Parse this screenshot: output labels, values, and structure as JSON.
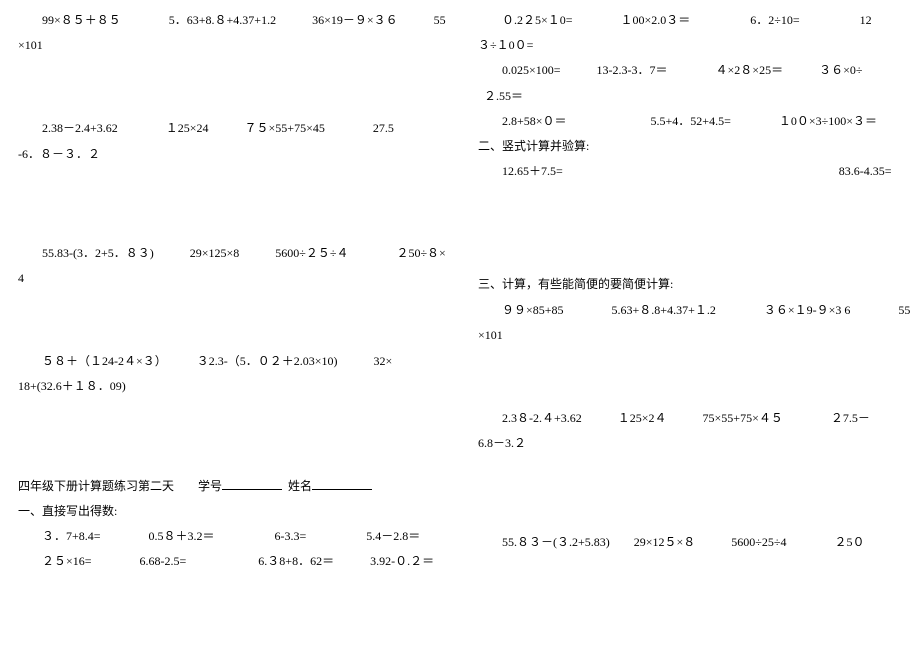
{
  "left": {
    "l1": "99×８５＋８５　　　　5．63+8.８+4.37+1.2　　　36×19－９×３６　　　55",
    "l2": "×101",
    "l3": "2.38－2.4+3.62　　　　１25×24　　　７５×55+75×45　　　　27.5",
    "l4": "-6．８－３．２",
    "l5": "55.83-(3．2+5．８３)　　　29×125×8　　　5600÷２５÷４　　　　２50÷８×",
    "l6": "4",
    "l7": "５８＋（１24-2４×３）　　　３2.3-（5．０２＋2.03×10)　　　32×",
    "l8": "18+(32.6＋１８．09)",
    "title": "四年级下册计算题练习第二天",
    "xuehao": "学号",
    "xingming": "姓名",
    "sec1": "一、直接写出得数:",
    "row1a": "３．7+8.4=　　　　0.5８＋3.2＝　　　　　6-3.3=　　　　　5.4－2.8＝",
    "row1b": "２５×16=　　　　6.68-2.5=　　　　　　6.３8+8．62＝　　　3.92-０.２＝"
  },
  "right": {
    "r1": "０.2２5×１0=　　　　１00×2.0３＝　　　　　6．2÷10=　　　　　12",
    "r2": "３÷１0０=",
    "r3": "0.025×100=　　　13-2.3-3．7＝　　　　４×2８×25＝　　　３６×0÷",
    "r4": "２.55＝",
    "r5": "2.8+58×０＝　　　　　　　5.5+4．52+4.5=　　　　１0０×3÷100×３＝",
    "sec2": "二、竖式计算并验算:",
    "r6": "12.65＋7.5=　　　　　　　　　　　　　　　　　　　　　　　83.6-4.35=",
    "sec3": "三、计算，有些能简便的要简便计算:",
    "r7": "９９×85+85　　　　5.63+８.8+4.37+１.2　　　　３６×１9-９×3 6　　　　55",
    "r8": "×101",
    "r9": "2.3８-2.４+3.62　　　１25×2４　　　75×55+75×４５　　　　２7.5－",
    "r10": "6.8－3.２",
    "r11": "55.８３－(３.2+5.83)　　29×12５×８　　　5600÷25÷4　　　　２5０"
  }
}
